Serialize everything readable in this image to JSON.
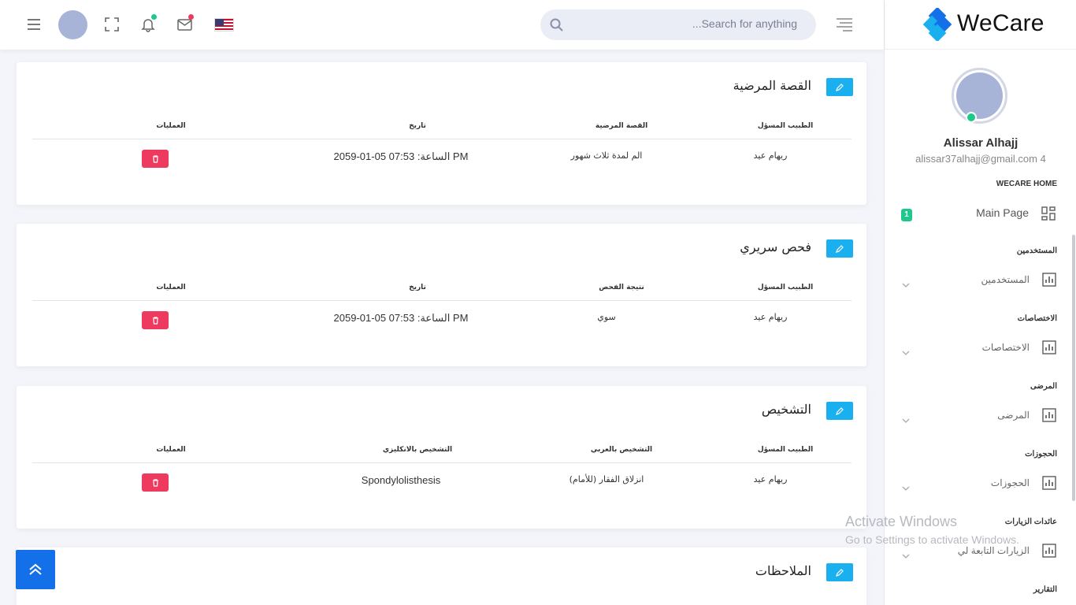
{
  "topbar": {
    "search_placeholder": "...Search for anything",
    "icons": [
      "menu-icon",
      "avatar",
      "fullscreen-icon",
      "bell-icon",
      "mail-icon",
      "us-flag-icon",
      "search-icon",
      "rtl-menu-icon"
    ],
    "notification_dot_color": "#1cc88a",
    "mail_dot_color": "#ee3a5f"
  },
  "sidebar": {
    "brand": "WeCare",
    "user_name": "Alissar Alhajj",
    "user_email": "alissar37alhajj@gmail.com 4",
    "home_section": "WECARE HOME",
    "main_page": "Main Page",
    "main_page_badge": "1",
    "sections": [
      {
        "title": "المستخدمين",
        "item": "المستخدمين"
      },
      {
        "title": "الاختصاصات",
        "item": "الاختصاصات"
      },
      {
        "title": "المرضى",
        "item": "المرضى"
      },
      {
        "title": "الحجوزات",
        "item": "الحجوزات"
      },
      {
        "title": "عائدات الزيارات",
        "item": "الزيارات التابعة لي"
      },
      {
        "title": "التقارير",
        "item": ""
      }
    ]
  },
  "cards": [
    {
      "title": "القصة المرضية",
      "headers": [
        "الطبيب المسؤل",
        "القصة المرضية",
        "تاريخ",
        "العمليات"
      ],
      "row": [
        "ريهام عيد",
        "الم لمدة ثلاث شهور",
        "2059-01-05 الساعة: 07:53 PM"
      ]
    },
    {
      "title": "فحص سريري",
      "headers": [
        "الطبيب المسؤل",
        "نتيجة الفحص",
        "تاريخ",
        "العمليات"
      ],
      "row": [
        "ريهام عيد",
        "سوي",
        "2059-01-05 الساعة: 07:53 PM"
      ]
    },
    {
      "title": "التشخيص",
      "headers": [
        "الطبيب المسؤل",
        "التشخيص بالعربي",
        "التشخيص بالانكليزي",
        "العمليات"
      ],
      "row": [
        "ريهام عيد",
        "انزلاق الفقار (للأمام)",
        "Spondylolisthesis"
      ]
    },
    {
      "title": "الملاحظات"
    }
  ],
  "watermark": {
    "line1": "Activate Windows",
    "line2": "Go to Settings to activate Windows."
  },
  "colors": {
    "accent": "#1ab0f0",
    "danger": "#ee3a5f",
    "primary": "#1470e8",
    "success": "#1cc88a"
  }
}
